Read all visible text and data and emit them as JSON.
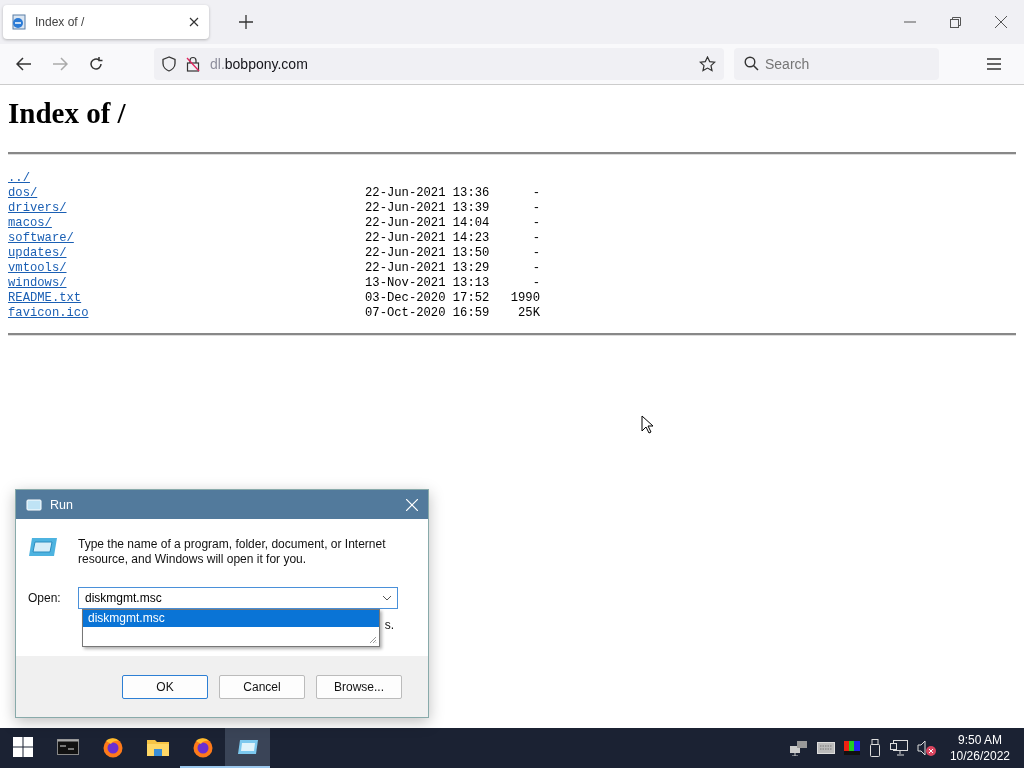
{
  "browser": {
    "tabs": [
      {
        "title": "Index of /",
        "selected": true
      }
    ],
    "url_host": "dl.",
    "url_domain": "bobpony.com",
    "search": {
      "placeholder": "Search"
    }
  },
  "page": {
    "heading": "Index of /",
    "entries": [
      {
        "name": "../"
      },
      {
        "name": "dos/",
        "date": "22-Jun-2021 13:36",
        "size": "-"
      },
      {
        "name": "drivers/",
        "date": "22-Jun-2021 13:39",
        "size": "-"
      },
      {
        "name": "macos/",
        "date": "22-Jun-2021 14:04",
        "size": "-"
      },
      {
        "name": "software/",
        "date": "22-Jun-2021 14:23",
        "size": "-"
      },
      {
        "name": "updates/",
        "date": "22-Jun-2021 13:50",
        "size": "-"
      },
      {
        "name": "vmtools/",
        "date": "22-Jun-2021 13:29",
        "size": "-"
      },
      {
        "name": "windows/",
        "date": "13-Nov-2021 13:13",
        "size": "-"
      },
      {
        "name": "README.txt",
        "date": "03-Dec-2020 17:52",
        "size": "1990"
      },
      {
        "name": "favicon.ico",
        "date": "07-Oct-2020 16:59",
        "size": "25K"
      }
    ]
  },
  "run_dialog": {
    "title": "Run",
    "message": "Type the name of a program, folder, document, or Internet resource, and Windows will open it for you.",
    "open_label": "Open:",
    "value": "diskmgmt.msc",
    "hidden_text_tail": "s.",
    "suggestions": [
      {
        "text": "diskmgmt.msc",
        "selected": true
      }
    ],
    "buttons": [
      "OK",
      "Cancel",
      "Browse..."
    ]
  },
  "taskbar": {
    "items": [
      {
        "kind": "start",
        "selected": false,
        "running": false
      },
      {
        "kind": "terminal",
        "selected": false,
        "running": false
      },
      {
        "kind": "firefox",
        "selected": false,
        "running": false
      },
      {
        "kind": "folder",
        "selected": false,
        "running": false
      },
      {
        "kind": "firefox",
        "selected": false,
        "running": true
      },
      {
        "kind": "run",
        "selected": true,
        "running": true
      }
    ],
    "time": "9:50 AM",
    "date": "10/26/2022"
  }
}
